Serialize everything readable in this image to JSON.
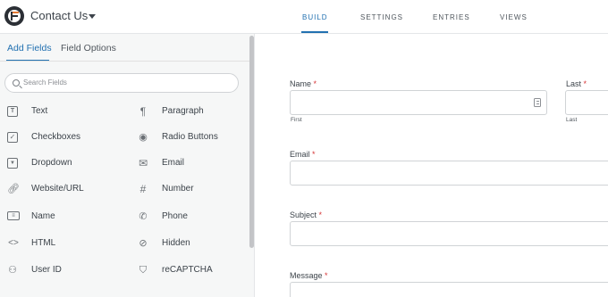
{
  "header": {
    "form_title": "Contact Us",
    "tabs": [
      {
        "label": "BUILD",
        "active": true
      },
      {
        "label": "SETTINGS",
        "active": false
      },
      {
        "label": "ENTRIES",
        "active": false
      },
      {
        "label": "VIEWS",
        "active": false
      }
    ]
  },
  "sidebar": {
    "tabs": [
      {
        "label": "Add Fields",
        "active": true
      },
      {
        "label": "Field Options",
        "active": false
      }
    ],
    "search_placeholder": "Search Fields",
    "fields": [
      {
        "label": "Text",
        "icon": "text-icon"
      },
      {
        "label": "Paragraph",
        "icon": "paragraph-icon"
      },
      {
        "label": "Checkboxes",
        "icon": "checkbox-icon"
      },
      {
        "label": "Radio Buttons",
        "icon": "radio-icon"
      },
      {
        "label": "Dropdown",
        "icon": "dropdown-icon"
      },
      {
        "label": "Email",
        "icon": "email-icon"
      },
      {
        "label": "Website/URL",
        "icon": "link-icon"
      },
      {
        "label": "Number",
        "icon": "hash-icon"
      },
      {
        "label": "Name",
        "icon": "id-card-icon"
      },
      {
        "label": "Phone",
        "icon": "phone-icon"
      },
      {
        "label": "HTML",
        "icon": "code-icon"
      },
      {
        "label": "Hidden",
        "icon": "eye-slash-icon"
      },
      {
        "label": "User ID",
        "icon": "user-icon"
      },
      {
        "label": "reCAPTCHA",
        "icon": "shield-icon"
      }
    ]
  },
  "form": {
    "name_label": "Name",
    "name_first_sublabel": "First",
    "last_label": "Last",
    "name_last_sublabel": "Last",
    "email_label": "Email",
    "subject_label": "Subject",
    "message_label": "Message",
    "required_marker": "*"
  },
  "colors": {
    "accent": "#2271b1",
    "required": "#d63638",
    "sidebar_bg": "#f6f7f7"
  }
}
